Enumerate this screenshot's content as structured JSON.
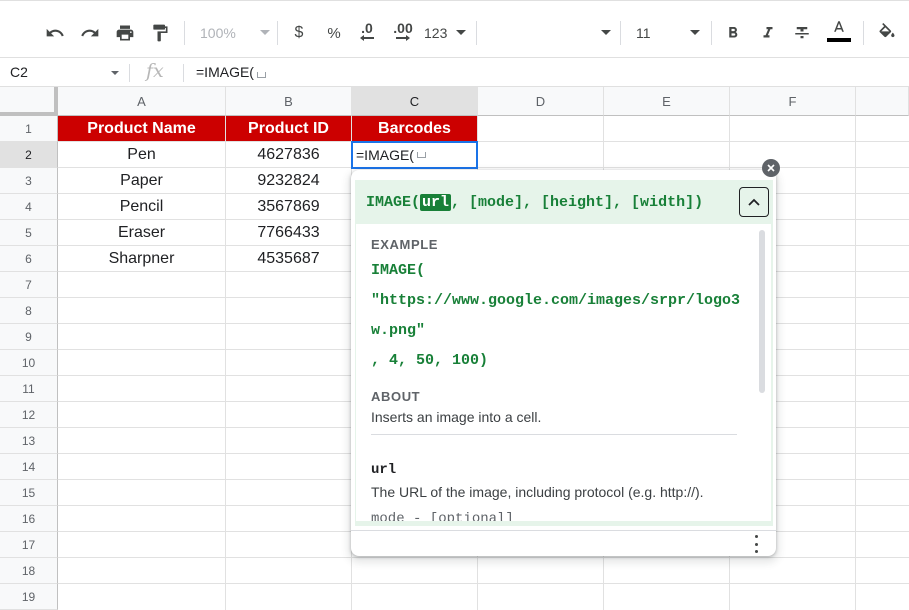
{
  "toolbar": {
    "zoom": "100%",
    "currency": "$",
    "percent": "%",
    "dec_decrease": ".0",
    "dec_increase": ".00",
    "more_formats": "123",
    "font_size": "11"
  },
  "formula_bar": {
    "cell_ref": "C2",
    "formula": "=IMAGE("
  },
  "columns": [
    "A",
    "B",
    "C",
    "D",
    "E",
    "F"
  ],
  "rows": [
    "1",
    "2",
    "3",
    "4",
    "5",
    "6",
    "7",
    "8",
    "9",
    "10",
    "11",
    "12",
    "13",
    "14",
    "15",
    "16",
    "17",
    "18",
    "19"
  ],
  "sheet": {
    "headers": [
      "Product Name",
      "Product ID",
      "Barcodes"
    ],
    "data": [
      {
        "name": "Pen",
        "id": "4627836"
      },
      {
        "name": "Paper",
        "id": "9232824"
      },
      {
        "name": "Pencil",
        "id": "3567869"
      },
      {
        "name": "Eraser",
        "id": "7766433"
      },
      {
        "name": "Sharpner",
        "id": "4535687"
      }
    ],
    "active_cell_value": "=IMAGE(",
    "header_color": "#cc0000"
  },
  "help": {
    "fn_name": "IMAGE(",
    "arg_active": "url",
    "args_rest": ", [mode], [height], [width])",
    "example_label": "EXAMPLE",
    "example_lines": [
      "IMAGE(",
      "\"https://www.google.com/images/srpr/logo3",
      "w.png\"",
      ", 4, 50, 100)"
    ],
    "about_label": "ABOUT",
    "about_text": "Inserts an image into a cell.",
    "arg1_name": "url",
    "arg1_desc": "The URL of the image, including protocol (e.g. http://).",
    "arg2_name": "mode - [optional]"
  }
}
